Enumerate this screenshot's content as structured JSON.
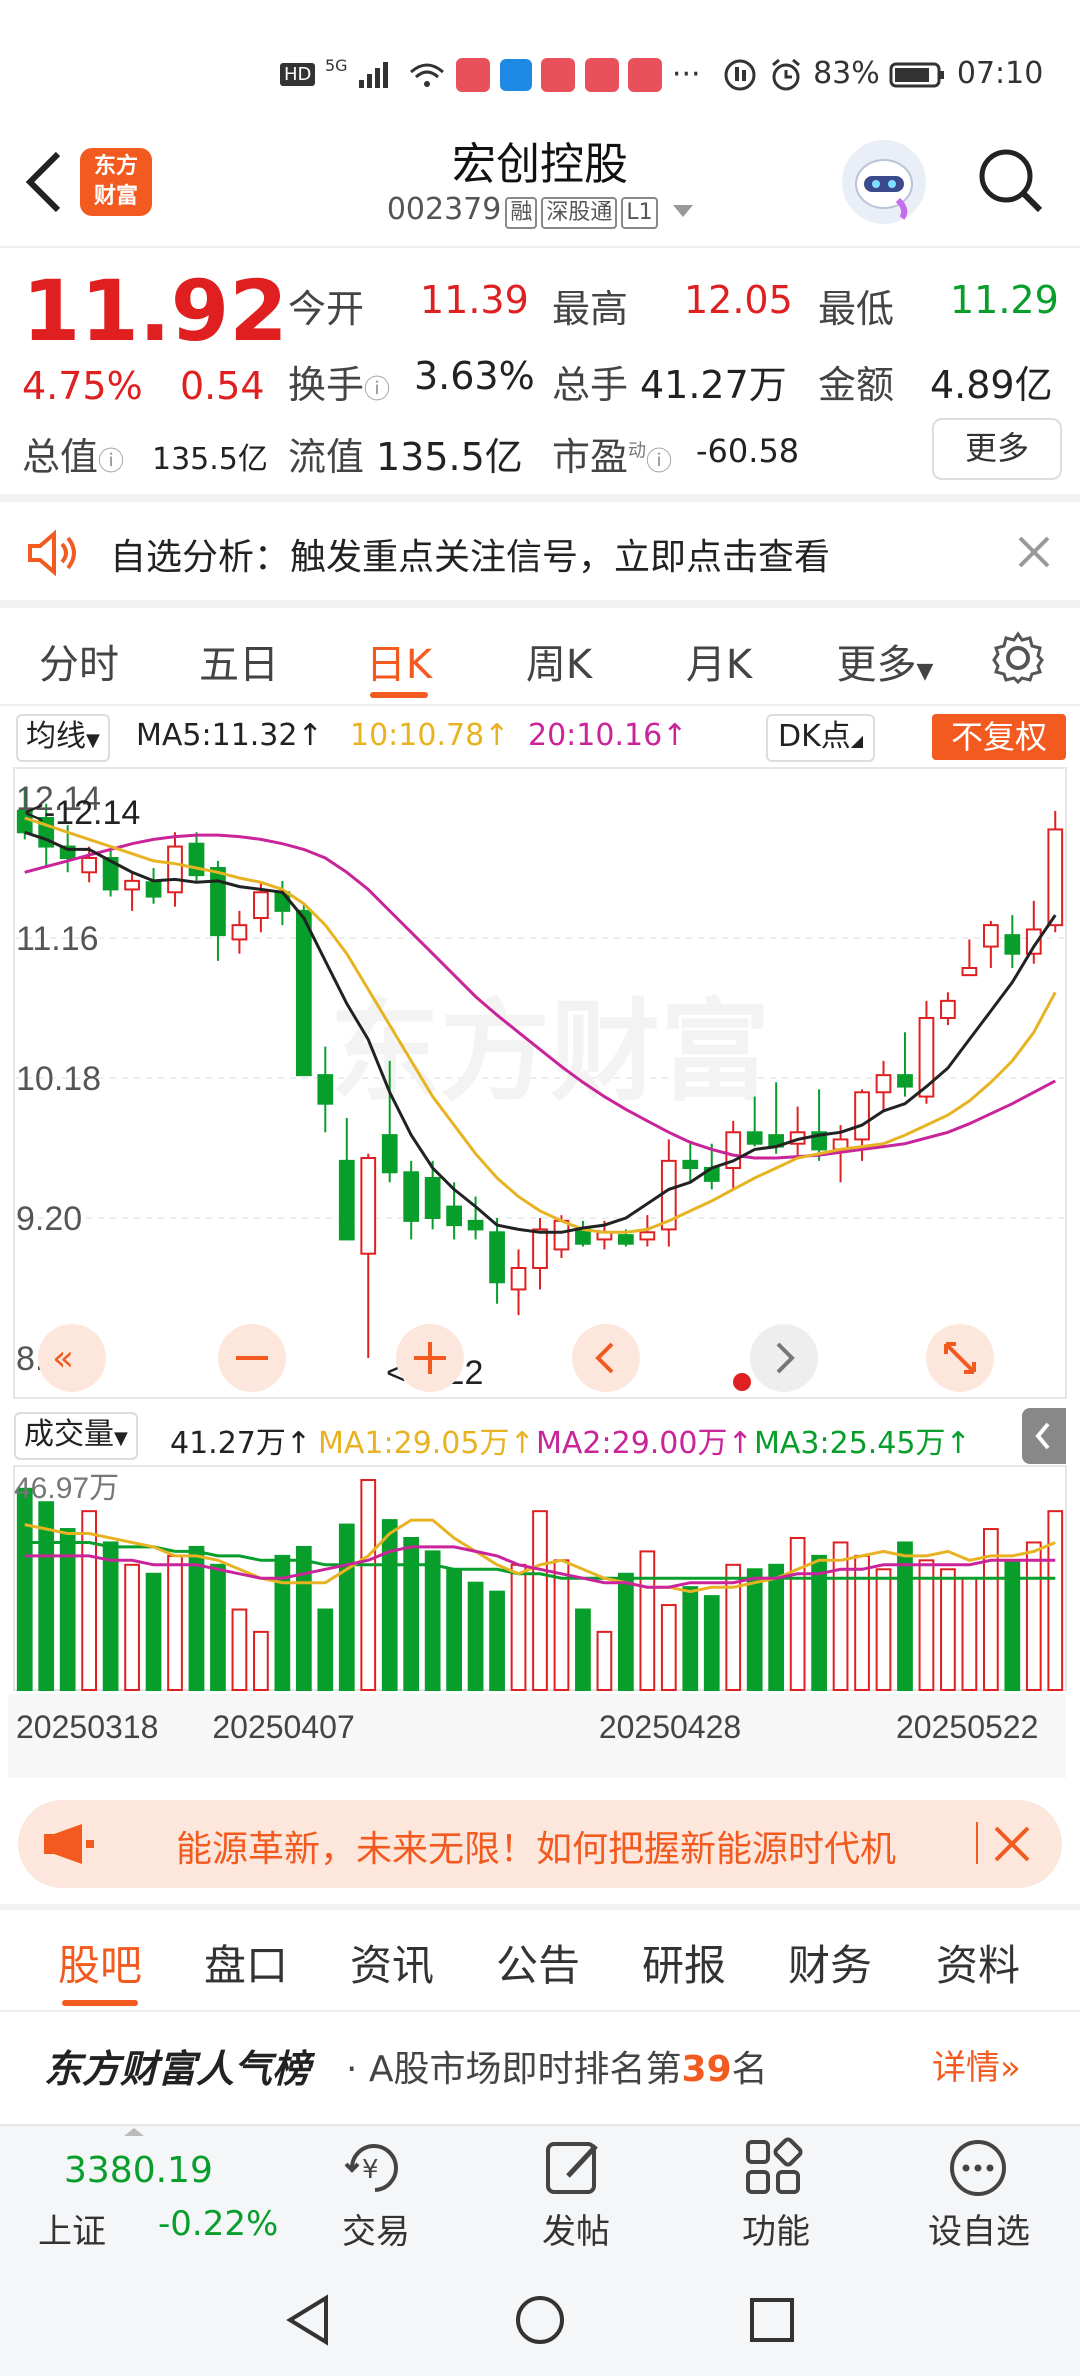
{
  "status": {
    "network": "5G",
    "battery": "83%",
    "time": "07:10"
  },
  "header": {
    "logo_text": "东方\n财富",
    "title": "宏创控股",
    "code": "002379",
    "tags": [
      "融",
      "深股通",
      "L1"
    ]
  },
  "quote": {
    "price": "11.92",
    "change_pct": "4.75%",
    "change": "0.54",
    "open_label": "今开",
    "open": "11.39",
    "high_label": "最高",
    "high": "12.05",
    "low_label": "最低",
    "low": "11.29",
    "turnover_label": "换手",
    "turnover": "3.63%",
    "volume_label": "总手",
    "volume": "41.27万",
    "amount_label": "金额",
    "amount": "4.89亿",
    "mktcap_label": "总值",
    "mktcap": "135.5亿",
    "float_label": "流值",
    "float": "135.5亿",
    "pe_label": "市盈",
    "pe_sup": "动",
    "pe": "-60.58",
    "more": "更多"
  },
  "alert": {
    "text": "自选分析：触发重点关注信号，立即点击查看"
  },
  "ktabs": [
    "分时",
    "五日",
    "日K",
    "周K",
    "月K",
    "更多"
  ],
  "ktab_active": "日K",
  "ma_bar": {
    "selector": "均线",
    "ma5": "MA5:11.32",
    "ma10": "10:10.78",
    "ma20": "20:10.16",
    "dk": "DK点",
    "fq": "不复权"
  },
  "vol_bar": {
    "selector": "成交量",
    "vol": "41.27万",
    "ma1": "MA1:29.05万",
    "ma2": "MA2:29.00万",
    "ma3": "MA3:25.45万"
  },
  "colors": {
    "up": "#e02020",
    "down": "#089e2b",
    "ma5": "#222222",
    "ma10": "#e8b322",
    "ma20": "#c9249a",
    "accent": "#f25a1f"
  },
  "chart_data": {
    "type": "candlestick",
    "price_axis_labels": [
      "12.14",
      "11.16",
      "10.18",
      "9.20",
      "8.22"
    ],
    "ylim": [
      8.22,
      12.14
    ],
    "max_marker": "<-12.14",
    "min_marker": "<-8.22",
    "volume_axis_label": "46.97万",
    "vol_ylim": [
      0,
      46.97
    ],
    "date_labels": [
      "20250318",
      "20250407",
      "20250428",
      "20250522"
    ],
    "candles": [
      {
        "o": 12.05,
        "h": 12.2,
        "l": 11.85,
        "c": 11.9
      },
      {
        "o": 12.0,
        "h": 12.1,
        "l": 11.65,
        "c": 11.8
      },
      {
        "o": 11.8,
        "h": 11.95,
        "l": 11.62,
        "c": 11.72
      },
      {
        "o": 11.62,
        "h": 11.8,
        "l": 11.55,
        "c": 11.72
      },
      {
        "o": 11.72,
        "h": 11.78,
        "l": 11.45,
        "c": 11.5
      },
      {
        "o": 11.5,
        "h": 11.62,
        "l": 11.35,
        "c": 11.56
      },
      {
        "o": 11.55,
        "h": 11.65,
        "l": 11.4,
        "c": 11.45
      },
      {
        "o": 11.48,
        "h": 11.9,
        "l": 11.38,
        "c": 11.8
      },
      {
        "o": 11.82,
        "h": 11.9,
        "l": 11.55,
        "c": 11.6
      },
      {
        "o": 11.65,
        "h": 11.7,
        "l": 11.0,
        "c": 11.18
      },
      {
        "o": 11.15,
        "h": 11.35,
        "l": 11.05,
        "c": 11.25
      },
      {
        "o": 11.3,
        "h": 11.55,
        "l": 11.2,
        "c": 11.48
      },
      {
        "o": 11.48,
        "h": 11.56,
        "l": 11.25,
        "c": 11.35
      },
      {
        "o": 11.35,
        "h": 11.4,
        "l": 10.8,
        "c": 10.2
      },
      {
        "o": 10.2,
        "h": 10.4,
        "l": 9.8,
        "c": 10.0
      },
      {
        "o": 9.6,
        "h": 9.9,
        "l": 9.2,
        "c": 9.05
      },
      {
        "o": 8.95,
        "h": 9.65,
        "l": 8.22,
        "c": 9.62
      },
      {
        "o": 9.78,
        "h": 10.3,
        "l": 9.45,
        "c": 9.52
      },
      {
        "o": 9.52,
        "h": 9.6,
        "l": 9.05,
        "c": 9.18
      },
      {
        "o": 9.48,
        "h": 9.6,
        "l": 9.12,
        "c": 9.2
      },
      {
        "o": 9.28,
        "h": 9.45,
        "l": 9.05,
        "c": 9.15
      },
      {
        "o": 9.18,
        "h": 9.35,
        "l": 9.05,
        "c": 9.12
      },
      {
        "o": 9.1,
        "h": 9.2,
        "l": 8.6,
        "c": 8.75
      },
      {
        "o": 8.7,
        "h": 8.98,
        "l": 8.52,
        "c": 8.85
      },
      {
        "o": 8.85,
        "h": 9.2,
        "l": 8.7,
        "c": 9.12
      },
      {
        "o": 8.98,
        "h": 9.22,
        "l": 8.92,
        "c": 9.18
      },
      {
        "o": 9.12,
        "h": 9.18,
        "l": 9.0,
        "c": 9.02
      },
      {
        "o": 9.05,
        "h": 9.18,
        "l": 8.98,
        "c": 9.1
      },
      {
        "o": 9.08,
        "h": 9.12,
        "l": 9.0,
        "c": 9.02
      },
      {
        "o": 9.05,
        "h": 9.22,
        "l": 9.0,
        "c": 9.1
      },
      {
        "o": 9.12,
        "h": 9.75,
        "l": 9.0,
        "c": 9.6
      },
      {
        "o": 9.6,
        "h": 9.72,
        "l": 9.45,
        "c": 9.55
      },
      {
        "o": 9.55,
        "h": 9.72,
        "l": 9.4,
        "c": 9.46
      },
      {
        "o": 9.55,
        "h": 9.88,
        "l": 9.4,
        "c": 9.8
      },
      {
        "o": 9.8,
        "h": 10.05,
        "l": 9.7,
        "c": 9.72
      },
      {
        "o": 9.78,
        "h": 10.15,
        "l": 9.65,
        "c": 9.7
      },
      {
        "o": 9.72,
        "h": 9.98,
        "l": 9.62,
        "c": 9.8
      },
      {
        "o": 9.8,
        "h": 10.1,
        "l": 9.6,
        "c": 9.68
      },
      {
        "o": 9.68,
        "h": 9.85,
        "l": 9.45,
        "c": 9.75
      },
      {
        "o": 9.75,
        "h": 10.1,
        "l": 9.6,
        "c": 10.08
      },
      {
        "o": 10.08,
        "h": 10.3,
        "l": 9.95,
        "c": 10.2
      },
      {
        "o": 10.2,
        "h": 10.5,
        "l": 10.05,
        "c": 10.12
      },
      {
        "o": 10.05,
        "h": 10.72,
        "l": 10.0,
        "c": 10.6
      },
      {
        "o": 10.6,
        "h": 10.78,
        "l": 10.55,
        "c": 10.72
      },
      {
        "o": 10.9,
        "h": 11.15,
        "l": 10.9,
        "c": 10.95
      },
      {
        "o": 11.1,
        "h": 11.28,
        "l": 10.95,
        "c": 11.25
      },
      {
        "o": 11.18,
        "h": 11.32,
        "l": 10.95,
        "c": 11.05
      },
      {
        "o": 11.05,
        "h": 11.42,
        "l": 10.98,
        "c": 11.22
      },
      {
        "o": 11.25,
        "h": 12.05,
        "l": 11.2,
        "c": 11.92
      }
    ],
    "volumes": [
      45,
      42,
      36,
      40,
      33,
      28,
      26,
      30,
      32,
      28,
      18,
      13,
      30,
      32,
      18,
      37,
      46.97,
      38,
      34,
      31,
      27,
      24,
      22,
      28,
      40,
      29,
      18,
      13,
      26,
      31,
      19,
      23,
      21,
      28,
      27,
      28,
      34,
      30,
      33,
      30,
      27,
      33,
      29,
      27,
      25,
      36,
      29,
      33,
      40
    ],
    "ma5": [
      11.9,
      11.85,
      11.78,
      11.78,
      11.7,
      11.62,
      11.56,
      11.57,
      11.55,
      11.56,
      11.52,
      11.5,
      11.48,
      11.3,
      11.0,
      10.7,
      10.45,
      10.08,
      9.78,
      9.55,
      9.4,
      9.28,
      9.15,
      9.12,
      9.1,
      9.1,
      9.13,
      9.15,
      9.2,
      9.3,
      9.4,
      9.45,
      9.55,
      9.6,
      9.68,
      9.7,
      9.75,
      9.78,
      9.8,
      9.85,
      9.95,
      10.0,
      10.12,
      10.25,
      10.45,
      10.65,
      10.85,
      11.1,
      11.32
    ],
    "ma10": [
      12.0,
      11.95,
      11.9,
      11.85,
      11.8,
      11.75,
      11.7,
      11.68,
      11.65,
      11.62,
      11.58,
      11.55,
      11.5,
      11.4,
      11.25,
      11.05,
      10.8,
      10.55,
      10.3,
      10.05,
      9.85,
      9.65,
      9.48,
      9.35,
      9.25,
      9.18,
      9.12,
      9.1,
      9.1,
      9.12,
      9.18,
      9.25,
      9.32,
      9.4,
      9.48,
      9.55,
      9.62,
      9.65,
      9.68,
      9.7,
      9.72,
      9.78,
      9.85,
      9.92,
      10.02,
      10.15,
      10.3,
      10.5,
      10.78
    ],
    "ma20": [
      11.62,
      11.66,
      11.7,
      11.74,
      11.78,
      11.82,
      11.85,
      11.87,
      11.88,
      11.88,
      11.87,
      11.85,
      11.82,
      11.78,
      11.72,
      11.62,
      11.5,
      11.35,
      11.2,
      11.05,
      10.9,
      10.75,
      10.62,
      10.5,
      10.38,
      10.26,
      10.15,
      10.05,
      9.96,
      9.88,
      9.8,
      9.73,
      9.68,
      9.64,
      9.62,
      9.62,
      9.63,
      9.64,
      9.66,
      9.68,
      9.7,
      9.72,
      9.76,
      9.8,
      9.86,
      9.93,
      10.0,
      10.08,
      10.16
    ],
    "vma1": [
      37,
      36,
      35,
      35,
      34,
      33,
      32,
      30,
      30,
      29,
      27,
      25,
      24,
      24,
      24,
      27,
      30,
      35,
      38,
      38,
      34,
      31,
      28,
      26,
      28,
      29,
      27,
      25,
      24,
      23,
      23,
      22,
      23,
      23,
      24,
      25,
      27,
      29,
      29,
      30,
      31,
      30,
      30,
      31,
      29,
      30,
      30,
      31,
      33
    ],
    "vma2": [
      30,
      30,
      30,
      30,
      29,
      29,
      28,
      28,
      28,
      27,
      26,
      25,
      25,
      26,
      27,
      28,
      29,
      31,
      32,
      32,
      32,
      31,
      30,
      28,
      27,
      26,
      25,
      24,
      24,
      23,
      23,
      24,
      24,
      24,
      25,
      25,
      26,
      26,
      27,
      27,
      28,
      28,
      28,
      28,
      28,
      29,
      29,
      29,
      29
    ],
    "vma3": [
      33,
      33,
      33,
      33,
      32,
      32,
      32,
      31,
      31,
      30,
      30,
      29,
      29,
      29,
      28,
      28,
      28,
      28,
      28,
      28,
      27,
      27,
      27,
      26,
      26,
      25,
      25,
      25,
      25,
      25,
      25,
      25,
      25,
      25,
      25,
      25,
      25,
      25,
      25,
      25,
      25,
      25,
      25,
      25,
      25,
      25,
      25,
      25,
      25
    ]
  },
  "banner": {
    "text": "能源革新，未来无限！如何把握新能源时代机"
  },
  "btabs": [
    "股吧",
    "盘口",
    "资讯",
    "公告",
    "研报",
    "财务",
    "资料"
  ],
  "btab_active": "股吧",
  "rank": {
    "title": "东方财富人气榜",
    "text": "· A股市场即时排名第",
    "num": "39",
    "suffix": "名",
    "detail": "详情"
  },
  "nav": {
    "index_value": "3380.19",
    "index_name": "上证",
    "index_change": "-0.22%",
    "items": [
      "交易",
      "发帖",
      "功能",
      "设自选"
    ]
  }
}
